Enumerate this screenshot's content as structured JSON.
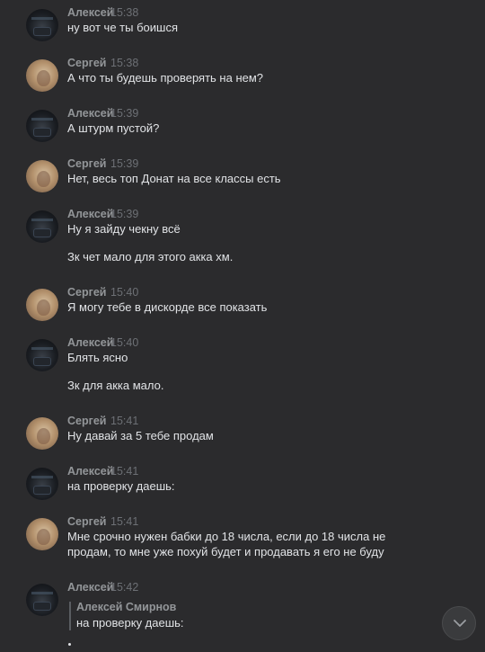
{
  "messages": [
    {
      "author": "Алексей",
      "time": "15:38",
      "avatar": "alexey-avatar",
      "lines": [
        "ну вот че ты боишся"
      ]
    },
    {
      "author": "Сергей",
      "time": "15:38",
      "avatar": "sergey-avatar",
      "lines": [
        "А что ты будешь проверять на нем?"
      ]
    },
    {
      "author": "Алексей",
      "time": "15:39",
      "avatar": "alexey-avatar",
      "lines": [
        "А штурм пустой?"
      ]
    },
    {
      "author": "Сергей",
      "time": "15:39",
      "avatar": "sergey-avatar",
      "lines": [
        "Нет, весь топ Донат на все классы есть"
      ]
    },
    {
      "author": "Алексей",
      "time": "15:39",
      "avatar": "alexey-avatar",
      "lines": [
        "Ну я зайду чекну всё",
        "Зк чет мало для этого акка хм."
      ]
    },
    {
      "author": "Сергей",
      "time": "15:40",
      "avatar": "sergey-avatar",
      "lines": [
        "Я могу тебе в дискорде все показать"
      ]
    },
    {
      "author": "Алексей",
      "time": "15:40",
      "avatar": "alexey-avatar",
      "lines": [
        "Блять ясно",
        "Зк для акка мало."
      ]
    },
    {
      "author": "Сергей",
      "time": "15:41",
      "avatar": "sergey-avatar",
      "lines": [
        "Ну давай за 5 тебе продам"
      ]
    },
    {
      "author": "Алексей",
      "time": "15:41",
      "avatar": "alexey-avatar",
      "lines": [
        "на проверку даешь:"
      ]
    },
    {
      "author": "Сергей",
      "time": "15:41",
      "avatar": "sergey-avatar",
      "lines": [
        "Мне срочно нужен бабки до 18 числа, если до 18 числа не",
        "продам, то мне уже похуй будет и продавать я его не буду"
      ]
    },
    {
      "author": "Алексей",
      "time": "15:42",
      "avatar": "alexey-avatar",
      "lines": []
    }
  ],
  "reply": {
    "author": "Алексей Смирнов",
    "text": "на проверку даешь:"
  },
  "icons": {
    "scroll_down": "chevron-down-icon"
  },
  "colors": {
    "background": "#2b2b2d",
    "author": "#939699",
    "time": "#6d7075",
    "text": "#e1e3e6"
  }
}
